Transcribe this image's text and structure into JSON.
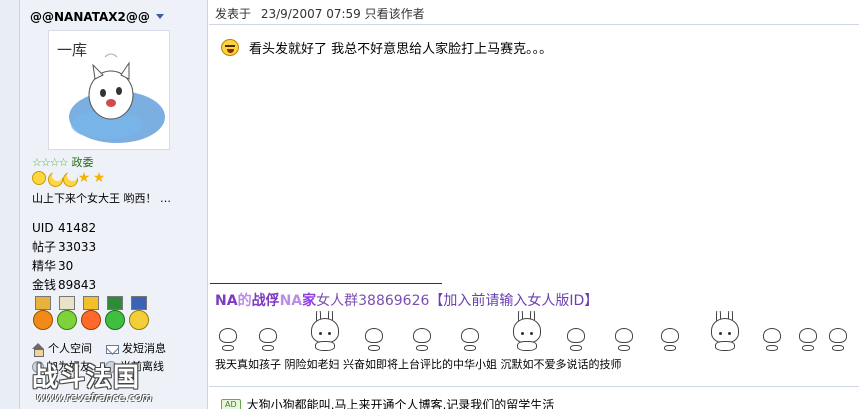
{
  "user": {
    "username": "@@NANATAX2@@",
    "avatar_caption": "一库",
    "rank_stars": "☆☆☆☆",
    "rank_title": "政委",
    "level_icon_names": [
      "sun-icon",
      "moon-icon",
      "moon-icon",
      "star-icon",
      "star-icon"
    ],
    "signature_short": "山上下来个女大王  哟西！  …",
    "stats": [
      {
        "label": "UID",
        "value": "41482"
      },
      {
        "label": "帖子",
        "value": "33033"
      },
      {
        "label": "精华",
        "value": "30"
      },
      {
        "label": "金钱",
        "value": "89843"
      }
    ],
    "medal_names": [
      "medal-orange",
      "medal-green-apple",
      "medal-red-flower",
      "medal-clover",
      "medal-blue-star"
    ],
    "links": {
      "space": "个人空间",
      "message": "发短消息",
      "add_friend": "加为好友",
      "status": "当前离线"
    }
  },
  "watermark": {
    "title": "战斗法国",
    "url": "www.revefrance.com"
  },
  "post": {
    "meta_prefix": "发表于",
    "date": "23/9/2007 07:59",
    "author_only": "只看该作者",
    "body": "看头发就好了  我总不好意思给人家脸打上马赛克。。。"
  },
  "signature": {
    "group_na1": "NA",
    "group_de": "的",
    "group_zhanfu": "战俘",
    "group_na2": "NA",
    "group_jia": "家",
    "group_name": "女人群38869626",
    "group_note": "【加入前请输入女人版ID】",
    "captions": "我天真如孩子  阴险如老妇  兴奋如即将上台评比的中华小姐  沉默如不爱多说话的技师"
  },
  "ad": {
    "badge": "AD",
    "text": "大狗小狗都能叫,马上来开通个人博客,记录我们的留学生活"
  },
  "colors": {
    "sidebar_bg": "#eef2f8",
    "group_purple": "#7d3bc2",
    "rank_green": "#2d7d19"
  }
}
